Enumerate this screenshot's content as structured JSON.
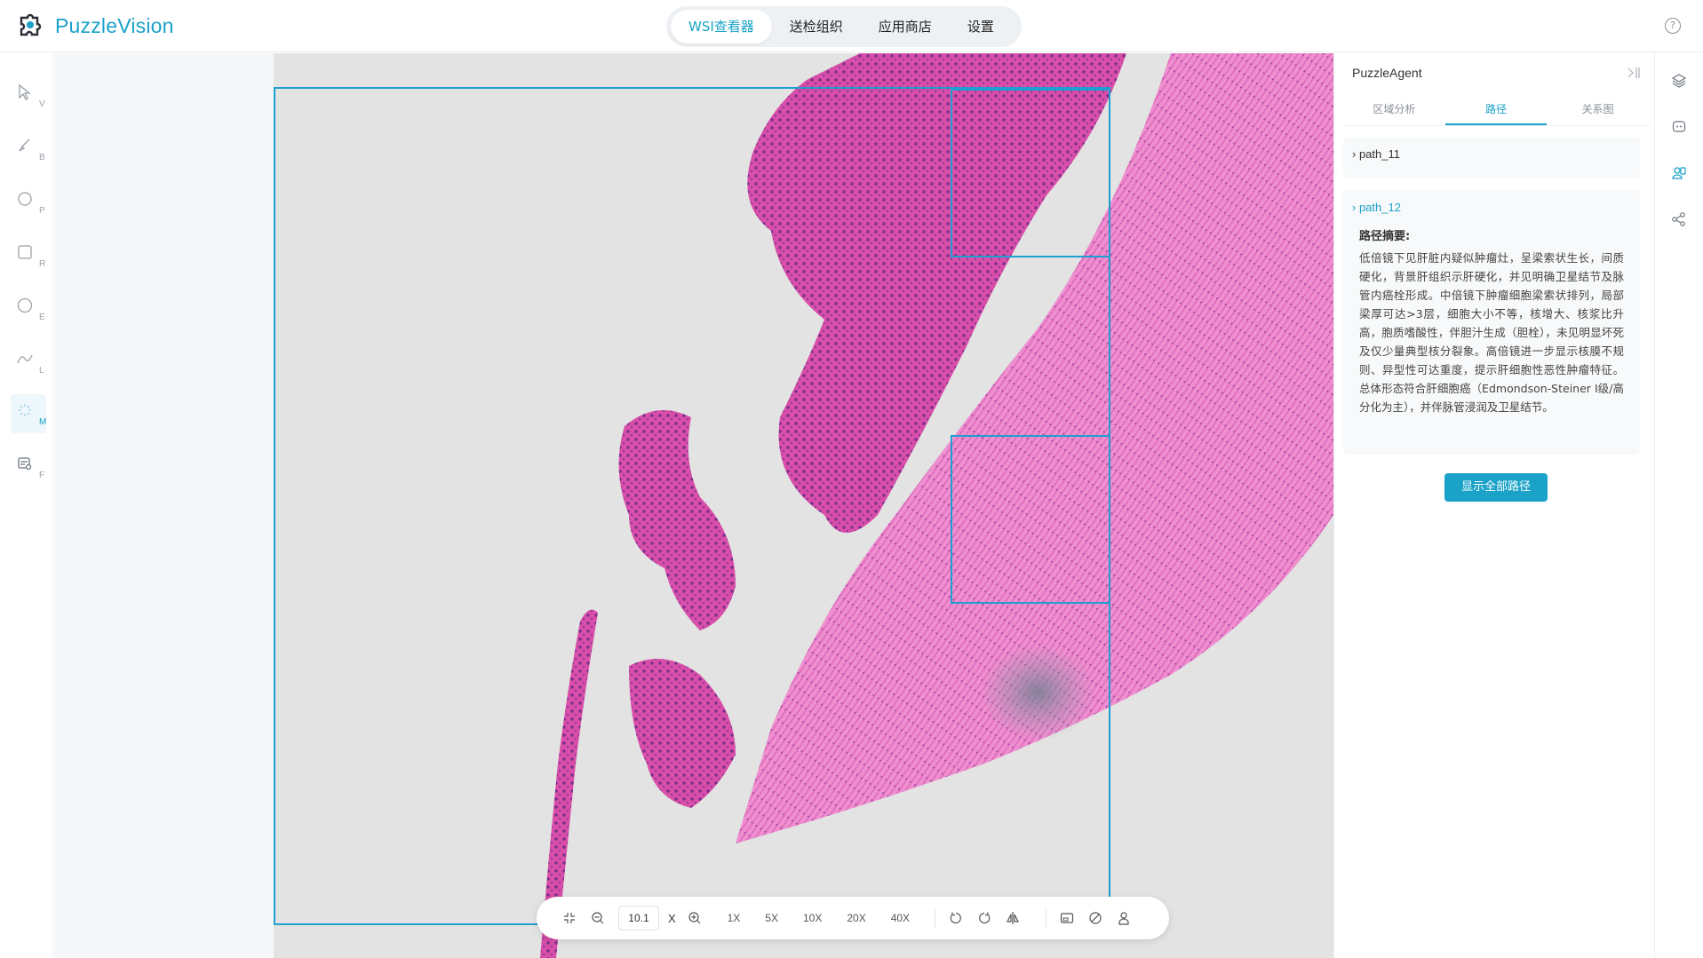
{
  "app": {
    "name": "PuzzleVision",
    "brand_color": "#1aa2c8",
    "nav": [
      {
        "label": "WSI查看器",
        "active": true
      },
      {
        "label": "送检组织",
        "active": false
      },
      {
        "label": "应用商店",
        "active": false
      },
      {
        "label": "设置",
        "active": false
      }
    ],
    "help_icon": "?"
  },
  "left_tools": [
    {
      "icon": "pointer-icon",
      "key": "V"
    },
    {
      "icon": "brush-icon",
      "key": "B"
    },
    {
      "icon": "polygon-icon",
      "key": "P"
    },
    {
      "icon": "rectangle-icon",
      "key": "R"
    },
    {
      "icon": "ellipse-icon",
      "key": "E"
    },
    {
      "icon": "line-icon",
      "key": "L"
    },
    {
      "icon": "magic-wand-icon",
      "key": "M",
      "active": true
    },
    {
      "icon": "folder-icon",
      "key": "F"
    }
  ],
  "viewer": {
    "zoom_value": "10.1",
    "zoom_suffix": "X",
    "magnifications": [
      "1X",
      "5X",
      "10X",
      "20X",
      "40X"
    ]
  },
  "panel": {
    "title": "PuzzleAgent",
    "tabs": [
      {
        "label": "区域分析",
        "active": false
      },
      {
        "label": "路径",
        "active": true
      },
      {
        "label": "关系图",
        "active": false
      }
    ],
    "paths": [
      {
        "name": "path_11",
        "expanded": false
      },
      {
        "name": "path_12",
        "expanded": true
      }
    ],
    "summary_title": "路径摘要:",
    "summary_text": "低倍镜下见肝脏内疑似肿瘤灶，呈梁索状生长，间质硬化，背景肝组织示肝硬化，并见明确卫星结节及脉管内癌栓形成。中倍镜下肿瘤细胞梁索状排列，局部梁厚可达>3层，细胞大小不等，核增大、核浆比升高，胞质嗜酸性，伴胆汁生成（胆栓），未见明显坏死及仅少量典型核分裂象。高倍镜进一步显示核膜不规则、异型性可达重度，提示肝细胞性恶性肿瘤特征。总体形态符合肝细胞癌（Edmondson-Steiner I级/高分化为主），并伴脉管浸润及卫星结节。",
    "show_all_label": "显示全部路径"
  }
}
